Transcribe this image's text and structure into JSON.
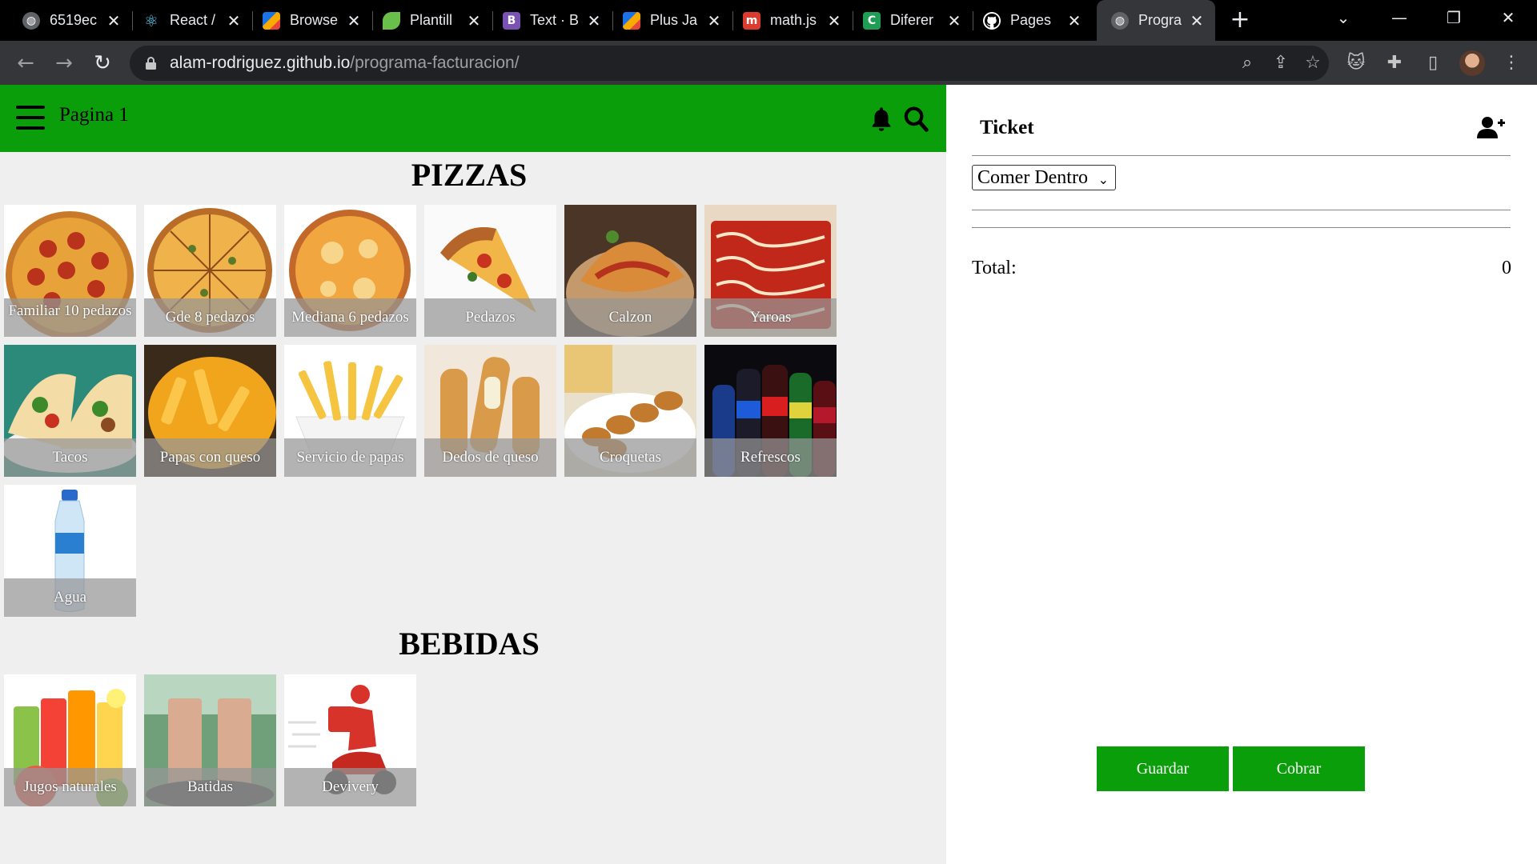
{
  "browser": {
    "tabs": [
      {
        "title": "6519ec",
        "icon": "globe-icon"
      },
      {
        "title": "React /",
        "icon": "react-icon"
      },
      {
        "title": "Browse",
        "icon": "pluralsight-icon"
      },
      {
        "title": "Plantill",
        "icon": "leaf-icon"
      },
      {
        "title": "Text · B",
        "icon": "bootstrap-icon"
      },
      {
        "title": "Plus Ja",
        "icon": "pluralsight-icon"
      },
      {
        "title": "math.js",
        "icon": "m-icon"
      },
      {
        "title": "Diferer",
        "icon": "c-icon"
      },
      {
        "title": "Pages",
        "icon": "github-icon"
      },
      {
        "title": "Progra",
        "icon": "globe-icon"
      }
    ],
    "url_host": "alam-rodriguez.github.io",
    "url_path": "/programa-facturacion/"
  },
  "appbar": {
    "title": "Pagina 1"
  },
  "sections": {
    "pizzas": {
      "title": "PIZZAS",
      "items": [
        {
          "label": "Familiar 10 pedazos"
        },
        {
          "label": "Gde 8 pedazos"
        },
        {
          "label": "Mediana 6 pedazos"
        },
        {
          "label": "Pedazos"
        },
        {
          "label": "Calzon"
        },
        {
          "label": "Yaroas"
        },
        {
          "label": "Tacos"
        },
        {
          "label": "Papas con queso"
        },
        {
          "label": "Servicio de papas"
        },
        {
          "label": "Dedos de queso"
        },
        {
          "label": "Croquetas"
        },
        {
          "label": "Refrescos"
        },
        {
          "label": "Agua"
        }
      ]
    },
    "bebidas": {
      "title": "BEBIDAS",
      "items": [
        {
          "label": "Jugos naturales"
        },
        {
          "label": "Batidas"
        },
        {
          "label": "Devivery"
        }
      ]
    }
  },
  "ticket": {
    "title": "Ticket",
    "order_type": "Comer Dentro",
    "total_label": "Total:",
    "total_value": "0",
    "save_label": "Guardar",
    "charge_label": "Cobrar"
  },
  "colors": {
    "brand_green": "#0a9e0a",
    "background_gray": "#efefef"
  }
}
